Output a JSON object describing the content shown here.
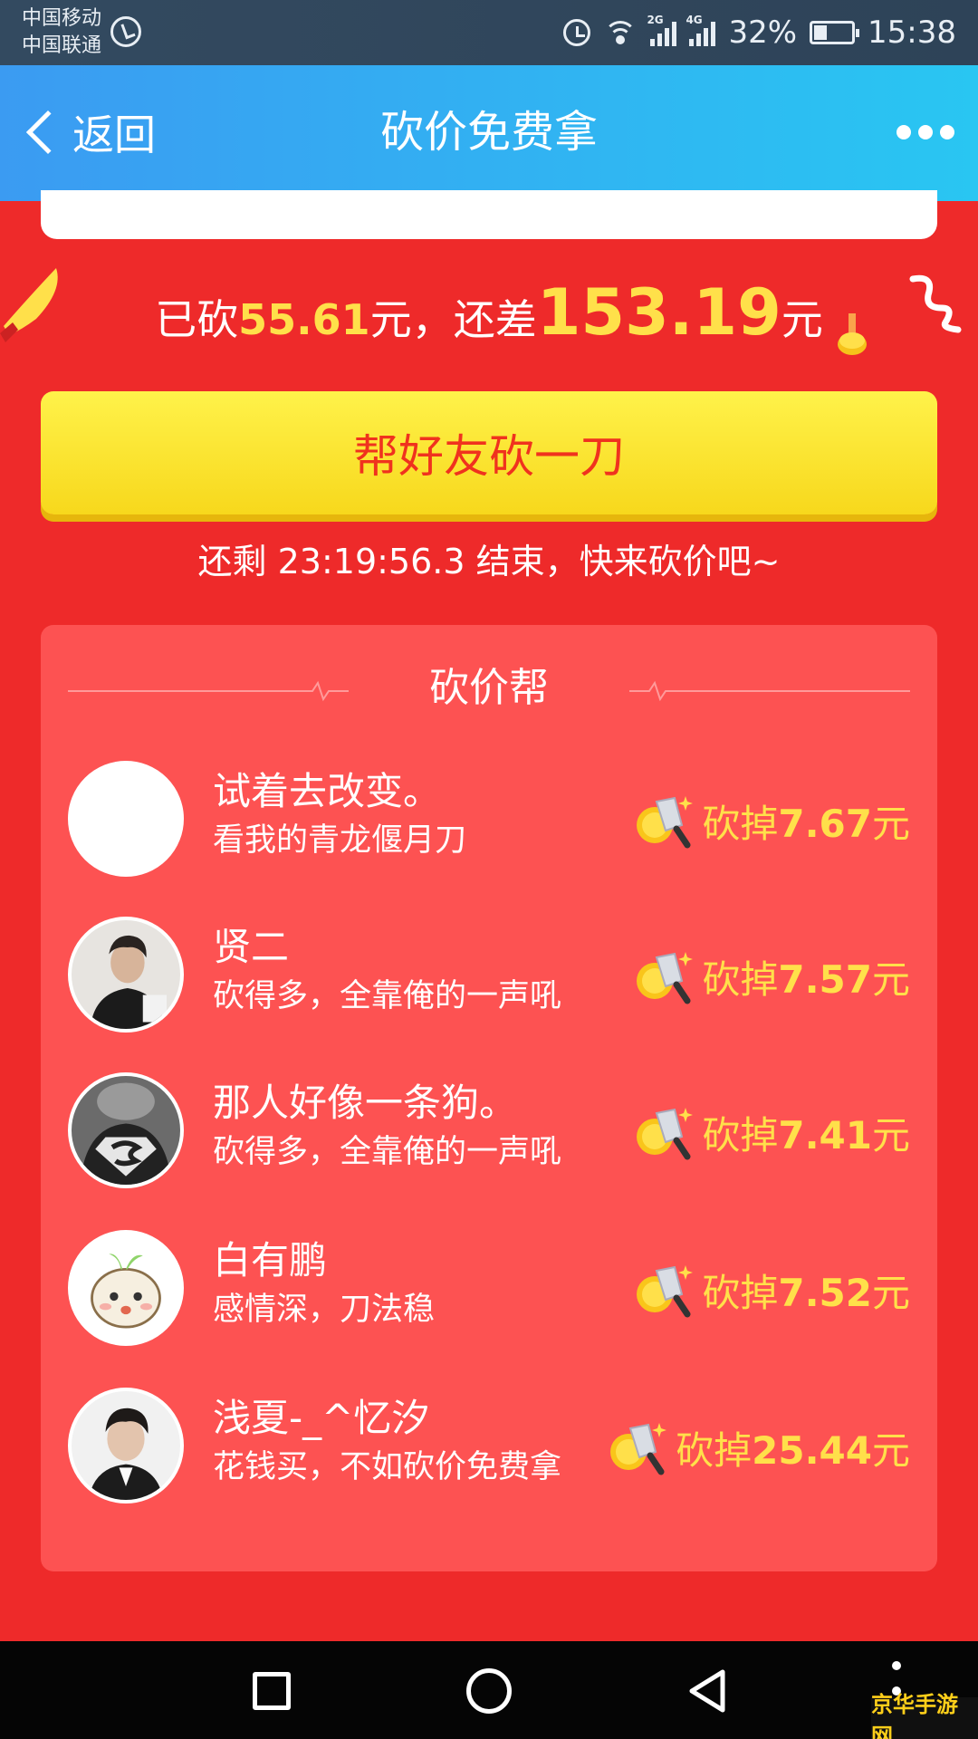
{
  "status_bar": {
    "carrier_1": "中国移动",
    "carrier_2": "中国联通",
    "net_1": "2G",
    "net_2": "4G",
    "battery": "32%",
    "time": "15:38"
  },
  "nav": {
    "back_label": "返回",
    "title": "砍价免费拿",
    "more_icon": "more-dots-icon"
  },
  "progress": {
    "prefix": "已砍",
    "cut_amount": "55.61",
    "middle": "元，还差",
    "remaining_amount": "153.19",
    "suffix": "元"
  },
  "help_button": {
    "label": "帮好友砍一刀"
  },
  "countdown": {
    "text": "还剩 23:19:56.3 结束，快来砍价吧~"
  },
  "helpers_panel": {
    "title": "砍价帮",
    "amount_prefix": "砍掉",
    "amount_suffix": "元",
    "helpers": [
      {
        "name": "试着去改变。",
        "message": "看我的青龙偃月刀",
        "amount": "7.67"
      },
      {
        "name": "贤二",
        "message": "砍得多，全靠俺的一声吼",
        "amount": "7.57"
      },
      {
        "name": "那人好像一条狗。",
        "message": "砍得多，全靠俺的一声吼",
        "amount": "7.41"
      },
      {
        "name": "白有鹏",
        "message": "感情深，刀法稳",
        "amount": "7.52"
      },
      {
        "name": "浅夏-_^忆汐",
        "message": "花钱买，不如砍价免费拿",
        "amount": "25.44"
      }
    ]
  },
  "watermark": "京华手游网",
  "colors": {
    "background": "#ee2a2a",
    "panel": "#fd5252",
    "accent_yellow": "#ffe04a",
    "button_text": "#f0321e",
    "nav_gradient_start": "#3b9bf2",
    "nav_gradient_end": "#29c6f2"
  }
}
